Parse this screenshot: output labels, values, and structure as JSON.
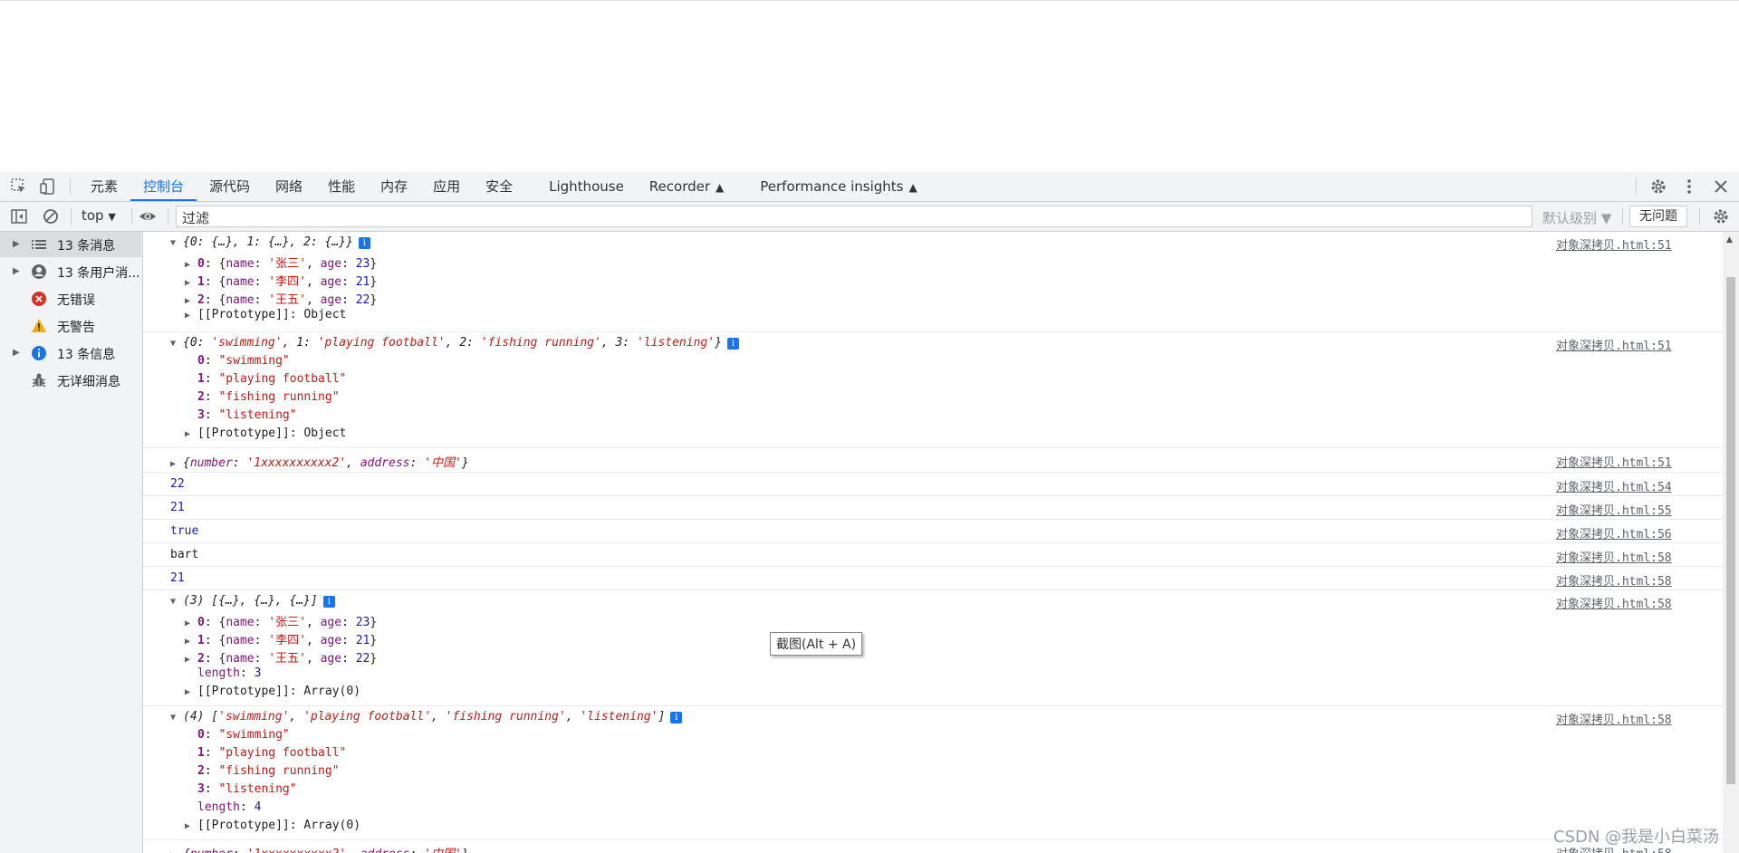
{
  "tabs": [
    "元素",
    "控制台",
    "源代码",
    "网络",
    "性能",
    "内存",
    "应用",
    "安全",
    "Lighthouse",
    "Recorder",
    "Performance insights"
  ],
  "toolbar": {
    "context": "top",
    "filter_placeholder": "过滤",
    "levels": "默认级别 ▼",
    "no_issues": "无问题"
  },
  "sidebar": {
    "items": [
      {
        "label": "13 条消息",
        "icon": "list-icon"
      },
      {
        "label": "13 条用户消...",
        "icon": "user-icon"
      },
      {
        "label": "无错误",
        "icon": "error-icon"
      },
      {
        "label": "无警告",
        "icon": "warning-icon"
      },
      {
        "label": "13 条信息",
        "icon": "info-icon"
      },
      {
        "label": "无详细消息",
        "icon": "bug-icon"
      }
    ]
  },
  "console": {
    "src51": "对象深拷贝.html:51",
    "src54": "对象深拷贝.html:54",
    "src55": "对象深拷贝.html:55",
    "src56": "对象深拷贝.html:56",
    "src58": "对象深拷贝.html:58",
    "obj1_summary": "{0: {…}, 1: {…}, 2: {…}}",
    "people": [
      {
        "key": "0",
        "name": "'张三'",
        "age": "23"
      },
      {
        "key": "1",
        "name": "'李四'",
        "age": "21"
      },
      {
        "key": "2",
        "name": "'王五'",
        "age": "22"
      }
    ],
    "proto_object": "[[Prototype]]",
    "proto_object_val": "Object",
    "proto_array_val": "Array(0)",
    "obj2_summary_pre": "{0: ",
    "hobbies": [
      "\"swimming\"",
      "\"playing football\"",
      "\"fishing running\"",
      "\"listening\""
    ],
    "hobbies_q": [
      "'swimming'",
      "'playing football'",
      "'fishing running'",
      "'listening'"
    ],
    "obj3_number": "'1xxxxxxxxxx2'",
    "obj3_address": "'中国'",
    "v22": "22",
    "v21": "21",
    "vtrue": "true",
    "vbart": "bart",
    "arr1_prefix": "(3) [{…}, {…}, {…}]",
    "arr2_prefix": "(4) [",
    "length_key": "length",
    "len3": "3",
    "len4": "4"
  },
  "tooltip": "截图(Alt + A)",
  "watermark": "CSDN @我是小白菜汤"
}
